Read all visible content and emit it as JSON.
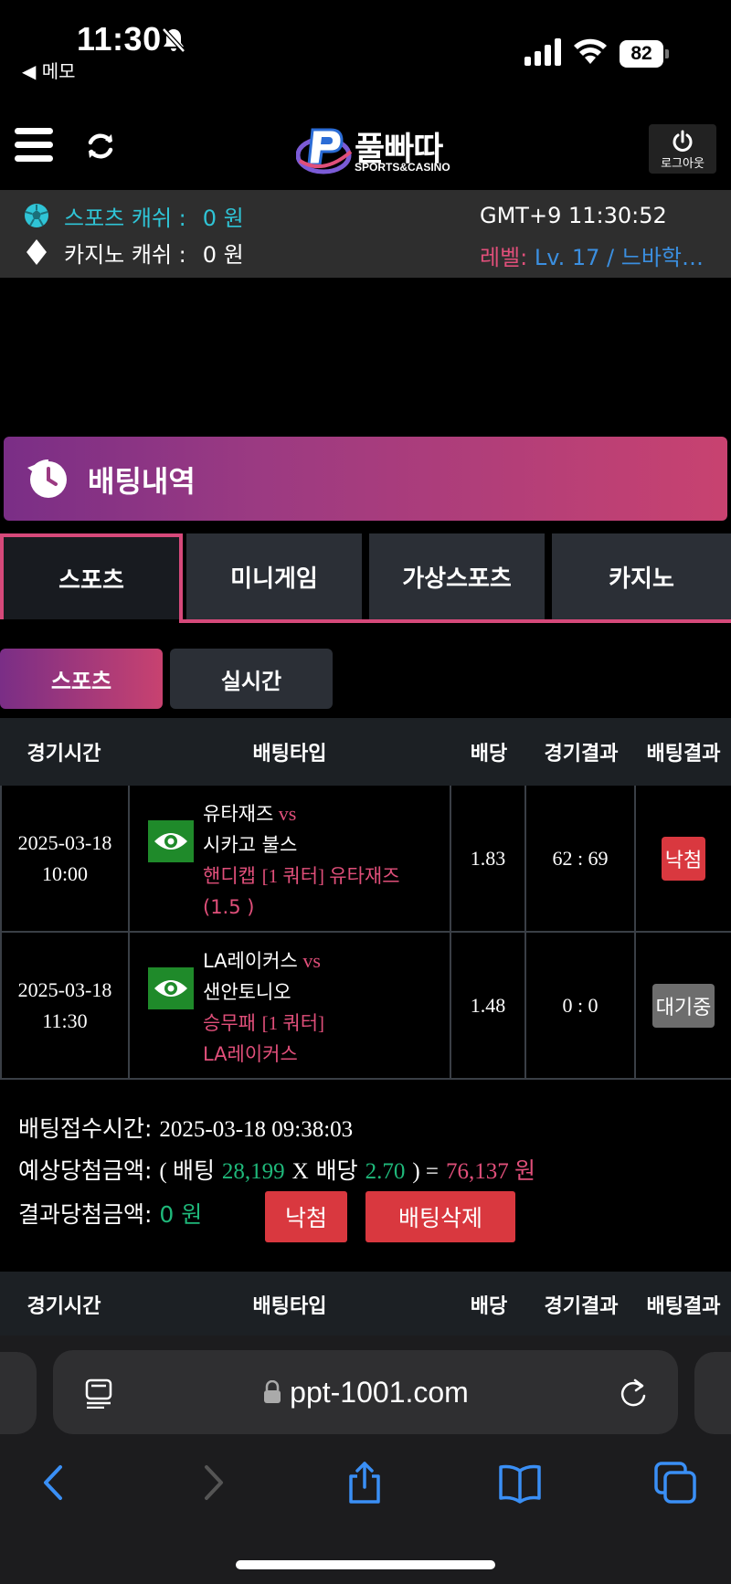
{
  "status_bar": {
    "time": "11:30",
    "back_label": "◀ 메모",
    "battery": "82"
  },
  "header": {
    "logo_text": "풀빠따",
    "logo_sub": "SPORTS&CASINO",
    "logout_label": "로그아웃"
  },
  "cash": {
    "sports_label": "스포츠 캐쉬 :",
    "sports_amount": "0 원",
    "casino_label": "카지노 캐쉬 :",
    "casino_amount": "0 원",
    "clock": "GMT+9 11:30:52",
    "level_label": "레벨:",
    "level_value": "Lv. 17 / 느바학…"
  },
  "banner": {
    "title": "배팅내역"
  },
  "tabs": [
    {
      "label": "스포츠"
    },
    {
      "label": "미니게임"
    },
    {
      "label": "가상스포츠"
    },
    {
      "label": "카지노"
    }
  ],
  "subtabs": [
    {
      "label": "스포츠"
    },
    {
      "label": "실시간"
    }
  ],
  "table": {
    "headers": [
      "경기시간",
      "배팅타입",
      "배당",
      "경기결과",
      "배팅결과"
    ],
    "rows": [
      {
        "date": "2025-03-18",
        "time": "10:00",
        "home": "유타재즈",
        "vs": "vs",
        "away": "시카고 불스",
        "pick_a": "핸디캡 ",
        "pick_b": "[1 쿼터] ",
        "pick_c": "유타재즈",
        "pick_d": "(1.5 )",
        "odds": "1.83",
        "score": "62 : 69",
        "result": "낙첨"
      },
      {
        "date": "2025-03-18",
        "time": "11:30",
        "home": "LA레이커스",
        "vs": "vs",
        "away": "샌안토니오",
        "pick_a": "승무패 ",
        "pick_b": "[1 쿼터]",
        "pick_c": "",
        "pick_d": "LA레이커스",
        "odds": "1.48",
        "score": "0 : 0",
        "result": "대기중"
      }
    ]
  },
  "summary": {
    "received_label": "배팅접수시간:",
    "received_value": "2025-03-18 09:38:03",
    "expected_label": "예상당첨금액:",
    "expected_open": "( 배팅",
    "bet_amount": "28,199",
    "x": "X",
    "odds_label": "배당",
    "total_odds": "2.70",
    "expected_close": ") =",
    "expected_win": "76,137 원",
    "result_label": "결과당첨금액:",
    "result_value": "0 원",
    "status_button": "낙첨",
    "delete_button": "배팅삭제"
  },
  "table2": {
    "headers": [
      "경기시간",
      "배팅타입",
      "배당",
      "경기결과",
      "배팅결과"
    ]
  },
  "browser": {
    "url": "ppt-1001.com"
  },
  "colors": {
    "accent_pink": "#d6497a",
    "gradient_purple": "#7a2e86",
    "teal": "#2fc4d6",
    "green": "#1fb87a",
    "red": "#d9383f"
  }
}
